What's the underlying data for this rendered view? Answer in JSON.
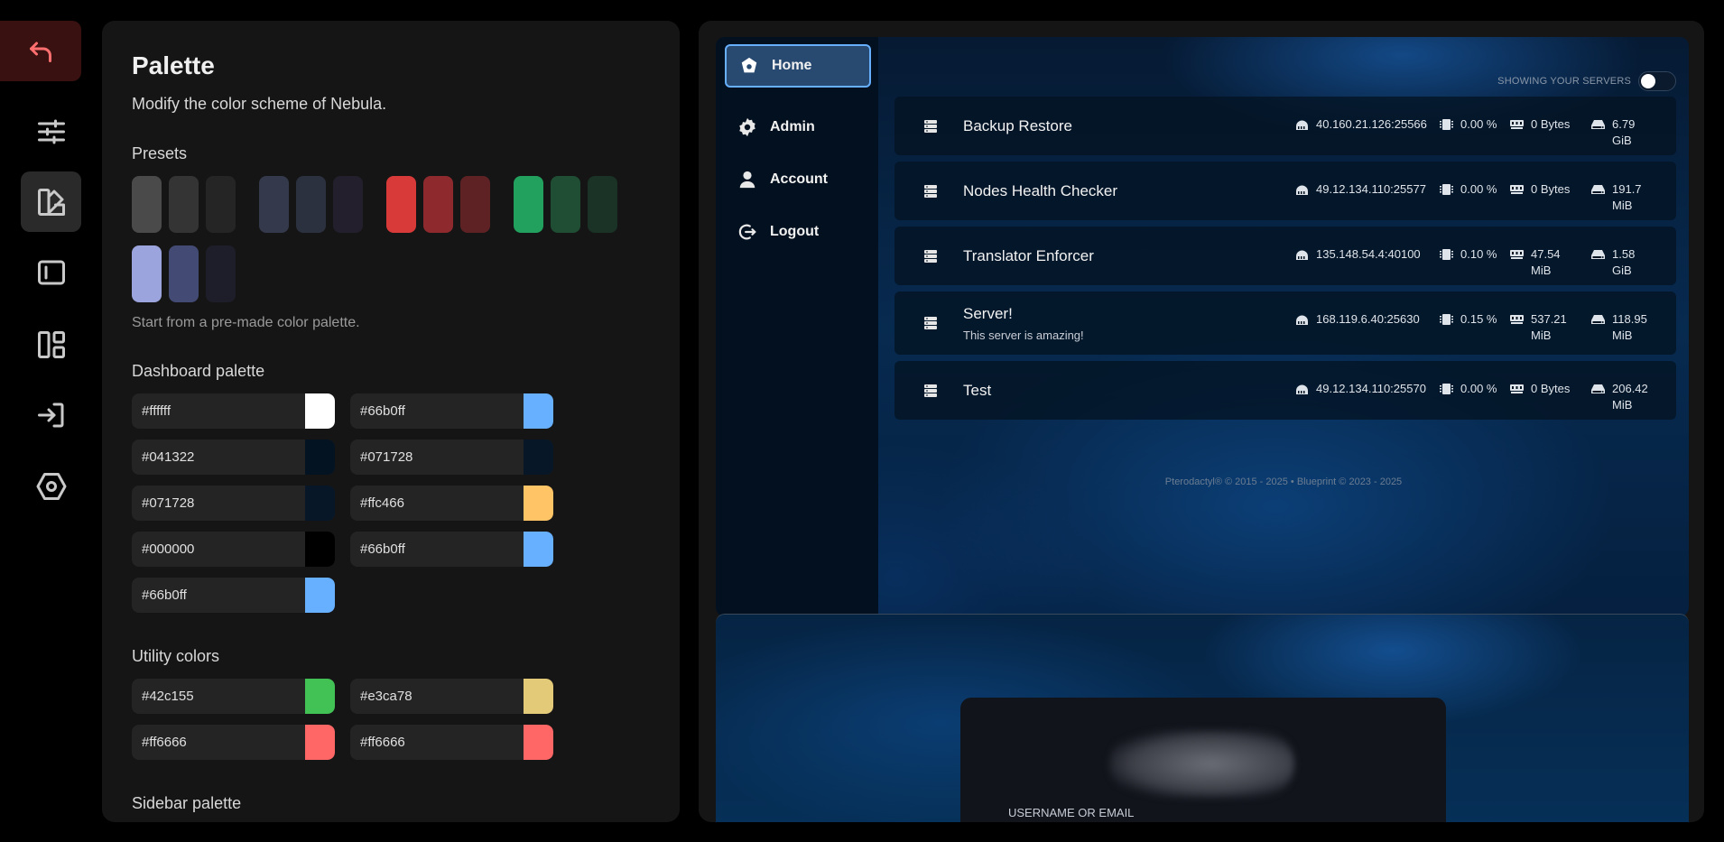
{
  "rail": {
    "icons": [
      "back-arrow-icon",
      "sliders-icon",
      "palette-icon",
      "sidebar-layout-icon",
      "dashboard-layout-icon",
      "sign-in-icon",
      "hexagon-gear-icon"
    ]
  },
  "panel": {
    "title": "Palette",
    "subtitle": "Modify the color scheme of Nebula.",
    "presets": {
      "title": "Presets",
      "hint": "Start from a pre-made color palette.",
      "items": [
        [
          "#4a4a4a",
          "#343434",
          "#252525"
        ],
        [
          "#343a4c",
          "#2c3140",
          "#231f2c"
        ],
        [
          "#d83a3a",
          "#8e2a2e",
          "#5e2225"
        ],
        [
          "#22a05e",
          "#1f4e34",
          "#1a3326"
        ],
        [
          "#9ba4dc",
          "#434a74",
          "#1e1e2a"
        ]
      ]
    },
    "dashboard": {
      "title": "Dashboard palette",
      "colors": [
        "#ffffff",
        "#66b0ff",
        "#041322",
        "#071728",
        "#071728",
        "#ffc466",
        "#000000",
        "#66b0ff",
        "#66b0ff"
      ]
    },
    "utility": {
      "title": "Utility colors",
      "colors": [
        "#42c155",
        "#e3ca78",
        "#ff6666",
        "#ff6666"
      ]
    },
    "sidebar": {
      "title": "Sidebar palette"
    }
  },
  "preview": {
    "nav": [
      {
        "label": "Home",
        "icon": "pterodactyl-logo-icon"
      },
      {
        "label": "Admin",
        "icon": "gear-icon"
      },
      {
        "label": "Account",
        "icon": "user-icon"
      },
      {
        "label": "Logout",
        "icon": "logout-icon"
      }
    ],
    "toggle_label": "SHOWING YOUR SERVERS",
    "servers": [
      {
        "name": "Backup Restore",
        "description": "",
        "ip": "40.160.21.126:25566",
        "cpu": "0.00 %",
        "memory": "0 Bytes",
        "disk": "6.79 GiB"
      },
      {
        "name": "Nodes Health Checker",
        "description": "",
        "ip": "49.12.134.110:25577",
        "cpu": "0.00 %",
        "memory": "0 Bytes",
        "disk": "191.7 MiB"
      },
      {
        "name": "Translator Enforcer",
        "description": "",
        "ip": "135.148.54.4:40100",
        "cpu": "0.10 %",
        "memory": "47.54 MiB",
        "disk": "1.58 GiB"
      },
      {
        "name": "Server!",
        "description": "This server is amazing!",
        "ip": "168.119.6.40:25630",
        "cpu": "0.15 %",
        "memory": "537.21 MiB",
        "disk": "118.95 MiB"
      },
      {
        "name": "Test",
        "description": "",
        "ip": "49.12.134.110:25570",
        "cpu": "0.00 %",
        "memory": "0 Bytes",
        "disk": "206.42 MiB"
      }
    ],
    "footer": "Pterodactyl® © 2015 - 2025  •  Blueprint © 2023 - 2025",
    "login": {
      "username_label": "USERNAME OR EMAIL"
    }
  }
}
